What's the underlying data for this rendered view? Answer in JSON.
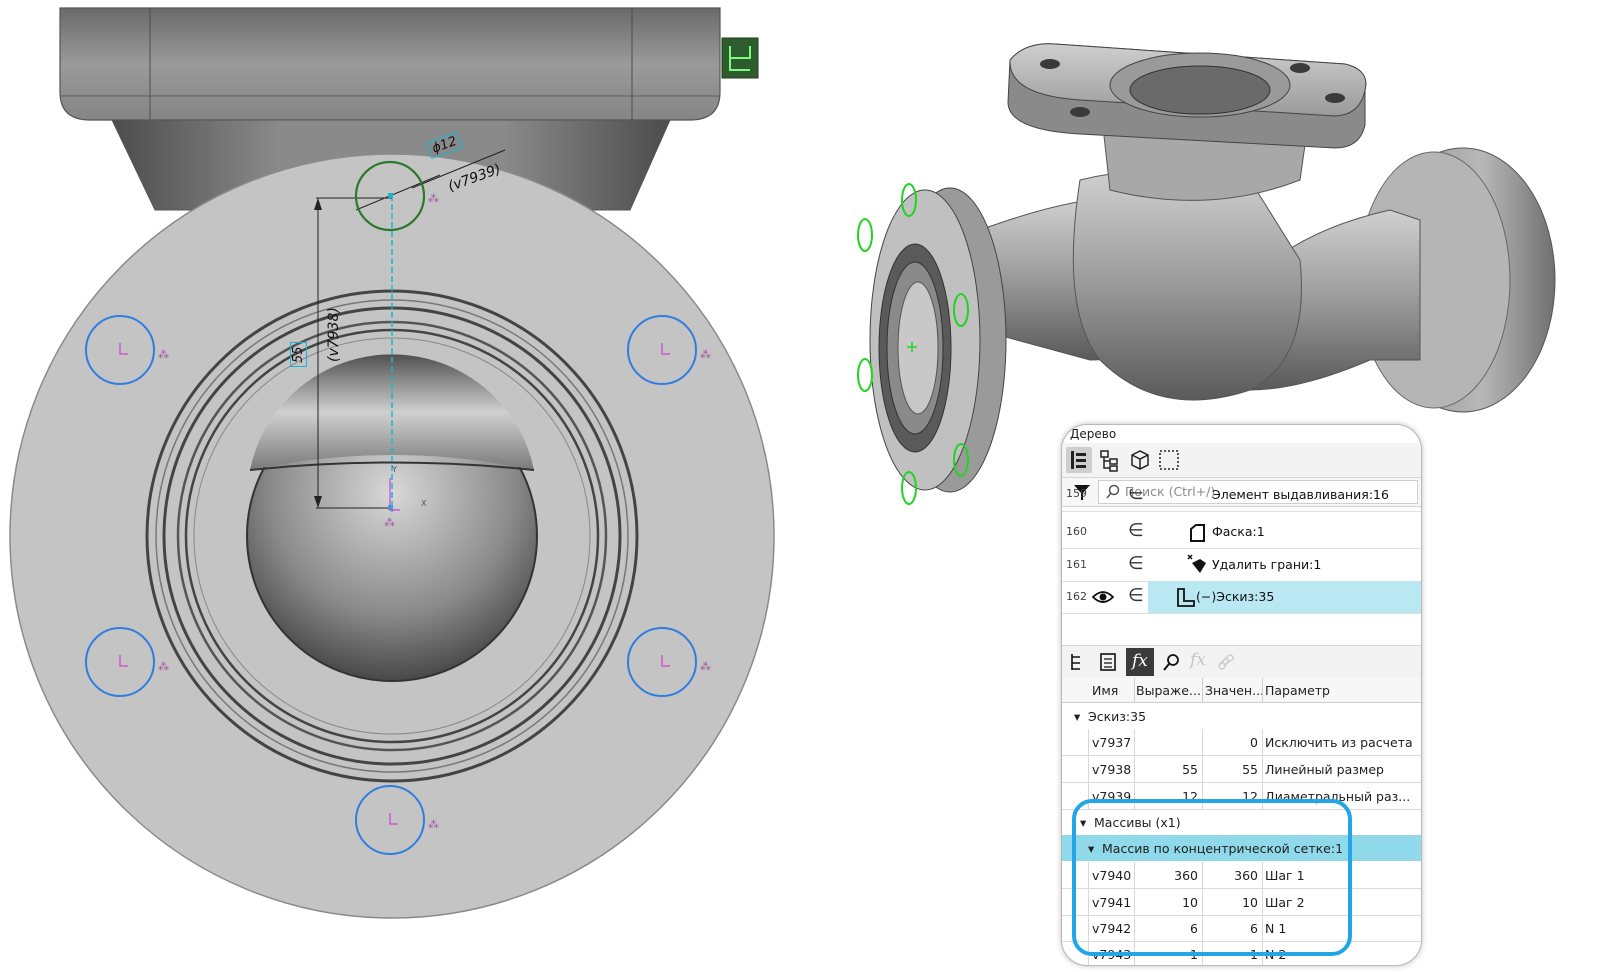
{
  "viewport_left": {
    "dims": {
      "diameter": "ϕ12",
      "diameter_var": "(v7939)",
      "linear": "55",
      "linear_var": "(v7938)"
    },
    "axis_labels": {
      "y": "Y",
      "x": "X"
    }
  },
  "tree_panel": {
    "title": "Дерево",
    "search_placeholder": "Поиск (Ctrl+/)",
    "rows": [
      {
        "num": "159",
        "label": "Элемент выдавливания:16"
      },
      {
        "num": "160",
        "label": "Фаска:1"
      },
      {
        "num": "161",
        "label": "Удалить грани:1"
      },
      {
        "num": "162",
        "label": "(−)Эскиз:35"
      }
    ],
    "columns": [
      "Имя",
      "Выраже...",
      "Значен...",
      "Параметр"
    ],
    "group": "Эскиз:35",
    "variables": [
      {
        "name": "v7937",
        "expr": "",
        "value": "0",
        "param": "Исключить из расчета"
      },
      {
        "name": "v7938",
        "expr": "55",
        "value": "55",
        "param": "Линейный размер"
      },
      {
        "name": "v7939",
        "expr": "12",
        "value": "12",
        "param": "Диаметральный раз..."
      }
    ],
    "arrays_group": "Массивы (x1)",
    "array_subgroup": "Массив по концентрической сетке:1",
    "array_vars": [
      {
        "name": "v7940",
        "expr": "360",
        "value": "360",
        "param": "Шаг 1"
      },
      {
        "name": "v7941",
        "expr": "10",
        "value": "10",
        "param": "Шаг 2"
      },
      {
        "name": "v7942",
        "expr": "6",
        "value": "6",
        "param": "N 1"
      },
      {
        "name": "v7943",
        "expr": "1",
        "value": "1",
        "param": "N 2"
      }
    ]
  },
  "colors": {
    "accent": "#22a6e6",
    "selection": "#b9e7f2",
    "group_row": "#8fd9ea",
    "hole_circle": "#2f7de1",
    "green_circle": "#2b7a2b",
    "model_gray": "#c2c2c2"
  }
}
